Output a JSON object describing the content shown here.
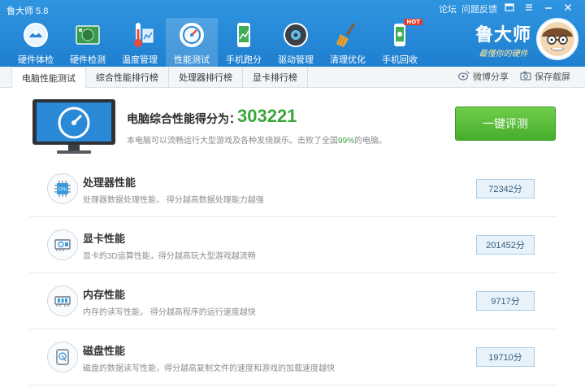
{
  "app": {
    "title": "鲁大师 5.8"
  },
  "window_links": {
    "forum": "论坛",
    "feedback": "问题反馈"
  },
  "nav": [
    {
      "label": "硬件体检",
      "icon": "hardware-check-icon"
    },
    {
      "label": "硬件检测",
      "icon": "hardware-detect-icon"
    },
    {
      "label": "温度管理",
      "icon": "temperature-icon"
    },
    {
      "label": "性能测试",
      "icon": "performance-gauge-icon",
      "active": true
    },
    {
      "label": "手机跑分",
      "icon": "phone-benchmark-icon"
    },
    {
      "label": "驱动管理",
      "icon": "driver-icon"
    },
    {
      "label": "清理优化",
      "icon": "broom-icon"
    },
    {
      "label": "手机回收",
      "icon": "phone-recycle-icon",
      "badge": "HOT"
    }
  ],
  "brand": {
    "name": "鲁大师",
    "slogan": "最懂你的硬件"
  },
  "tabs": [
    {
      "label": "电脑性能测试",
      "active": true
    },
    {
      "label": "综合性能排行榜"
    },
    {
      "label": "处理器排行榜"
    },
    {
      "label": "显卡排行榜"
    }
  ],
  "tools": {
    "share": "微博分享",
    "screenshot": "保存截屏"
  },
  "summary": {
    "score_label": "电脑综合性能得分为：",
    "score": "303221",
    "desc_prefix": "本电脑可以流畅运行大型游戏及各种发烧娱乐。击败了全国",
    "percent": "99%",
    "desc_suffix": "的电脑。",
    "eval_button": "一键评测"
  },
  "results": [
    {
      "title": "处理器性能",
      "desc": "处理器数据处理性能， 得分越高数据处理能力越强",
      "score": "72342分",
      "icon": "cpu-icon"
    },
    {
      "title": "显卡性能",
      "desc": "显卡的3D运算性能，得分越高玩大型游戏越流畅",
      "score": "201452分",
      "icon": "graphics-card-icon"
    },
    {
      "title": "内存性能",
      "desc": "内存的读写性能， 得分越高程序的运行速度越快",
      "score": "9717分",
      "icon": "memory-icon"
    },
    {
      "title": "磁盘性能",
      "desc": "磁盘的数据读写性能，得分越高复制文件的速度和游戏的加载速度越快",
      "score": "19710分",
      "icon": "disk-icon"
    }
  ],
  "colors": {
    "accent_blue": "#1f7fd0",
    "score_green": "#3ba53b",
    "button_green": "#46ad2c"
  }
}
